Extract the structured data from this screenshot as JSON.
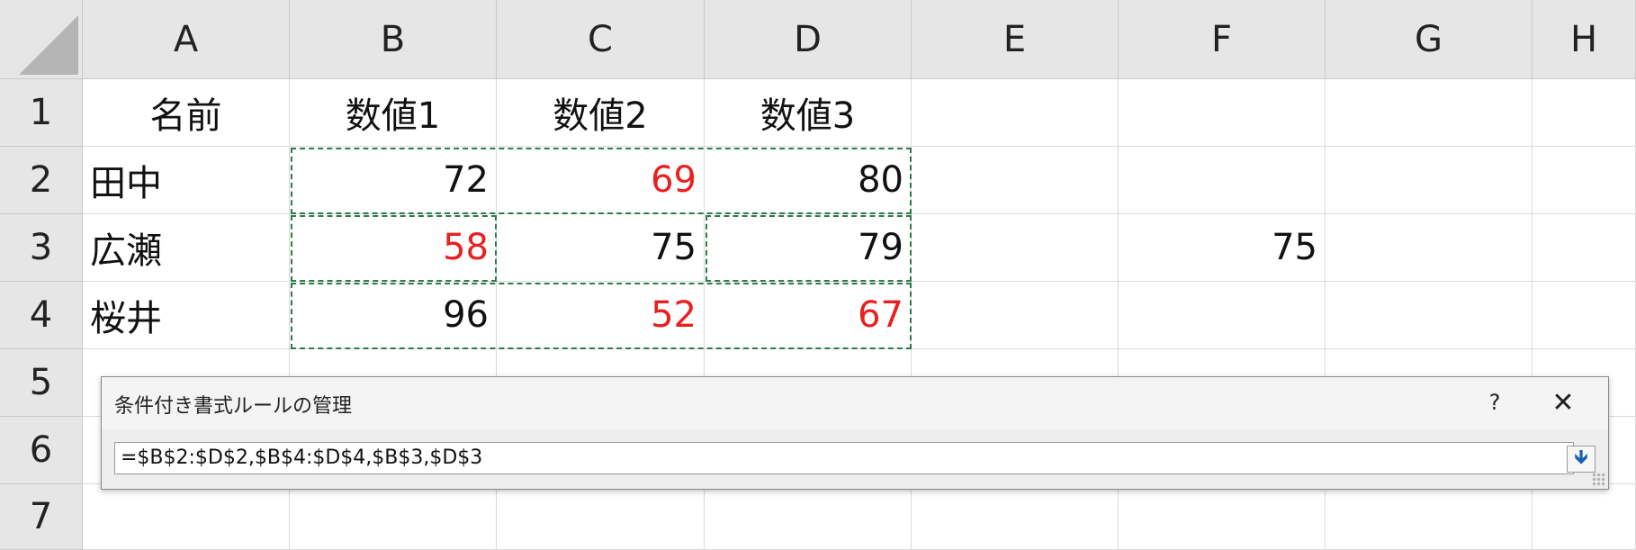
{
  "columns": [
    "A",
    "B",
    "C",
    "D",
    "E",
    "F",
    "G",
    "H"
  ],
  "rows": [
    "1",
    "2",
    "3",
    "4",
    "5",
    "6",
    "7"
  ],
  "cells": {
    "A1": {
      "text": "名前",
      "align": "center"
    },
    "B1": {
      "text": "数値1",
      "align": "center"
    },
    "C1": {
      "text": "数値2",
      "align": "center"
    },
    "D1": {
      "text": "数値3",
      "align": "center"
    },
    "A2": {
      "text": "田中",
      "align": "left"
    },
    "B2": {
      "text": "72",
      "align": "right"
    },
    "C2": {
      "text": "69",
      "align": "right",
      "color": "red"
    },
    "D2": {
      "text": "80",
      "align": "right"
    },
    "A3": {
      "text": "広瀬",
      "align": "left"
    },
    "B3": {
      "text": "58",
      "align": "right",
      "color": "red"
    },
    "C3": {
      "text": "75",
      "align": "right"
    },
    "D3": {
      "text": "79",
      "align": "right"
    },
    "F3": {
      "text": "75",
      "align": "right"
    },
    "A4": {
      "text": "桜井",
      "align": "left"
    },
    "B4": {
      "text": "96",
      "align": "right"
    },
    "C4": {
      "text": "52",
      "align": "right",
      "color": "red"
    },
    "D4": {
      "text": "67",
      "align": "right",
      "color": "red"
    }
  },
  "colors": {
    "red_text": "#e8201f",
    "marquee": "#2f7a4a"
  },
  "dialog": {
    "title": "条件付き書式ルールの管理",
    "help_label": "?",
    "close_label": "✕",
    "range_value": "=$B$2:$D$2,$B$4:$D$4,$B$3,$D$3",
    "collapse_icon": "collapse-arrow-icon",
    "collapse_label": "🡻"
  }
}
